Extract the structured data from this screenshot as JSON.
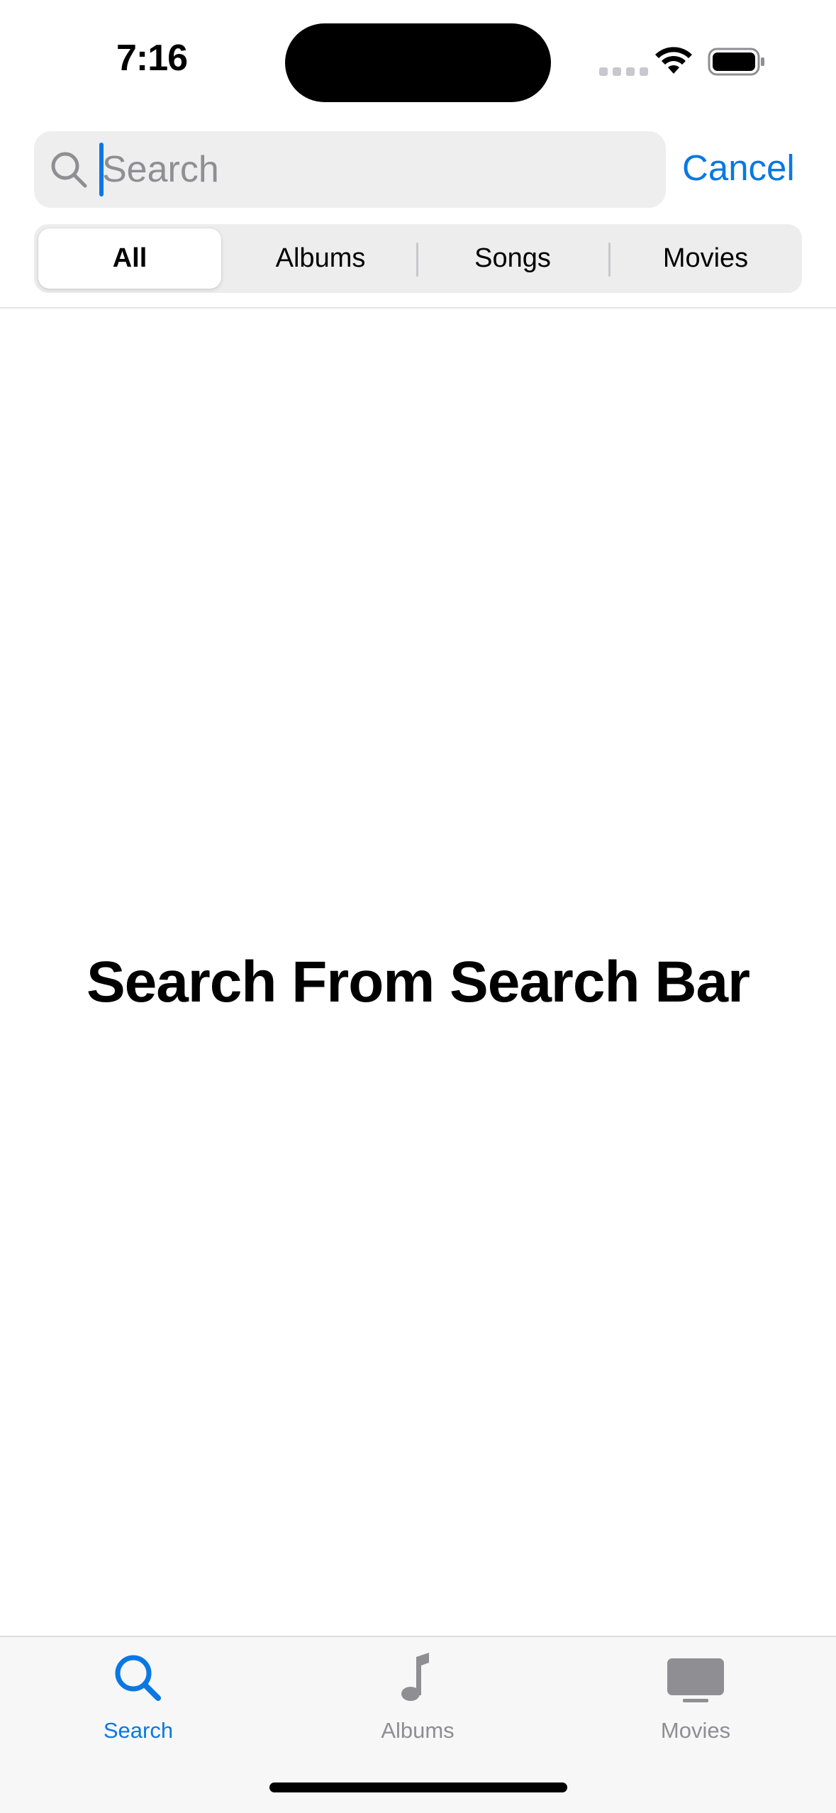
{
  "status_bar": {
    "time": "7:16",
    "icons": [
      "cellular-signal-icon",
      "wifi-icon",
      "battery-icon"
    ]
  },
  "search": {
    "placeholder": "Search",
    "value": "",
    "cancel_label": "Cancel"
  },
  "scope": {
    "selected": "All",
    "segments": [
      {
        "label": "All"
      },
      {
        "label": "Albums"
      },
      {
        "label": "Songs"
      },
      {
        "label": "Movies"
      }
    ]
  },
  "main": {
    "empty_message": "Search From Search Bar"
  },
  "tab_bar": {
    "selected": "Search",
    "items": [
      {
        "label": "Search",
        "icon": "magnifying-glass-icon"
      },
      {
        "label": "Albums",
        "icon": "music-note-icon"
      },
      {
        "label": "Movies",
        "icon": "tv-icon"
      }
    ]
  },
  "colors": {
    "accent": "#0a78e3",
    "inactive": "#8e8e93",
    "field_background": "#eeeeef"
  }
}
